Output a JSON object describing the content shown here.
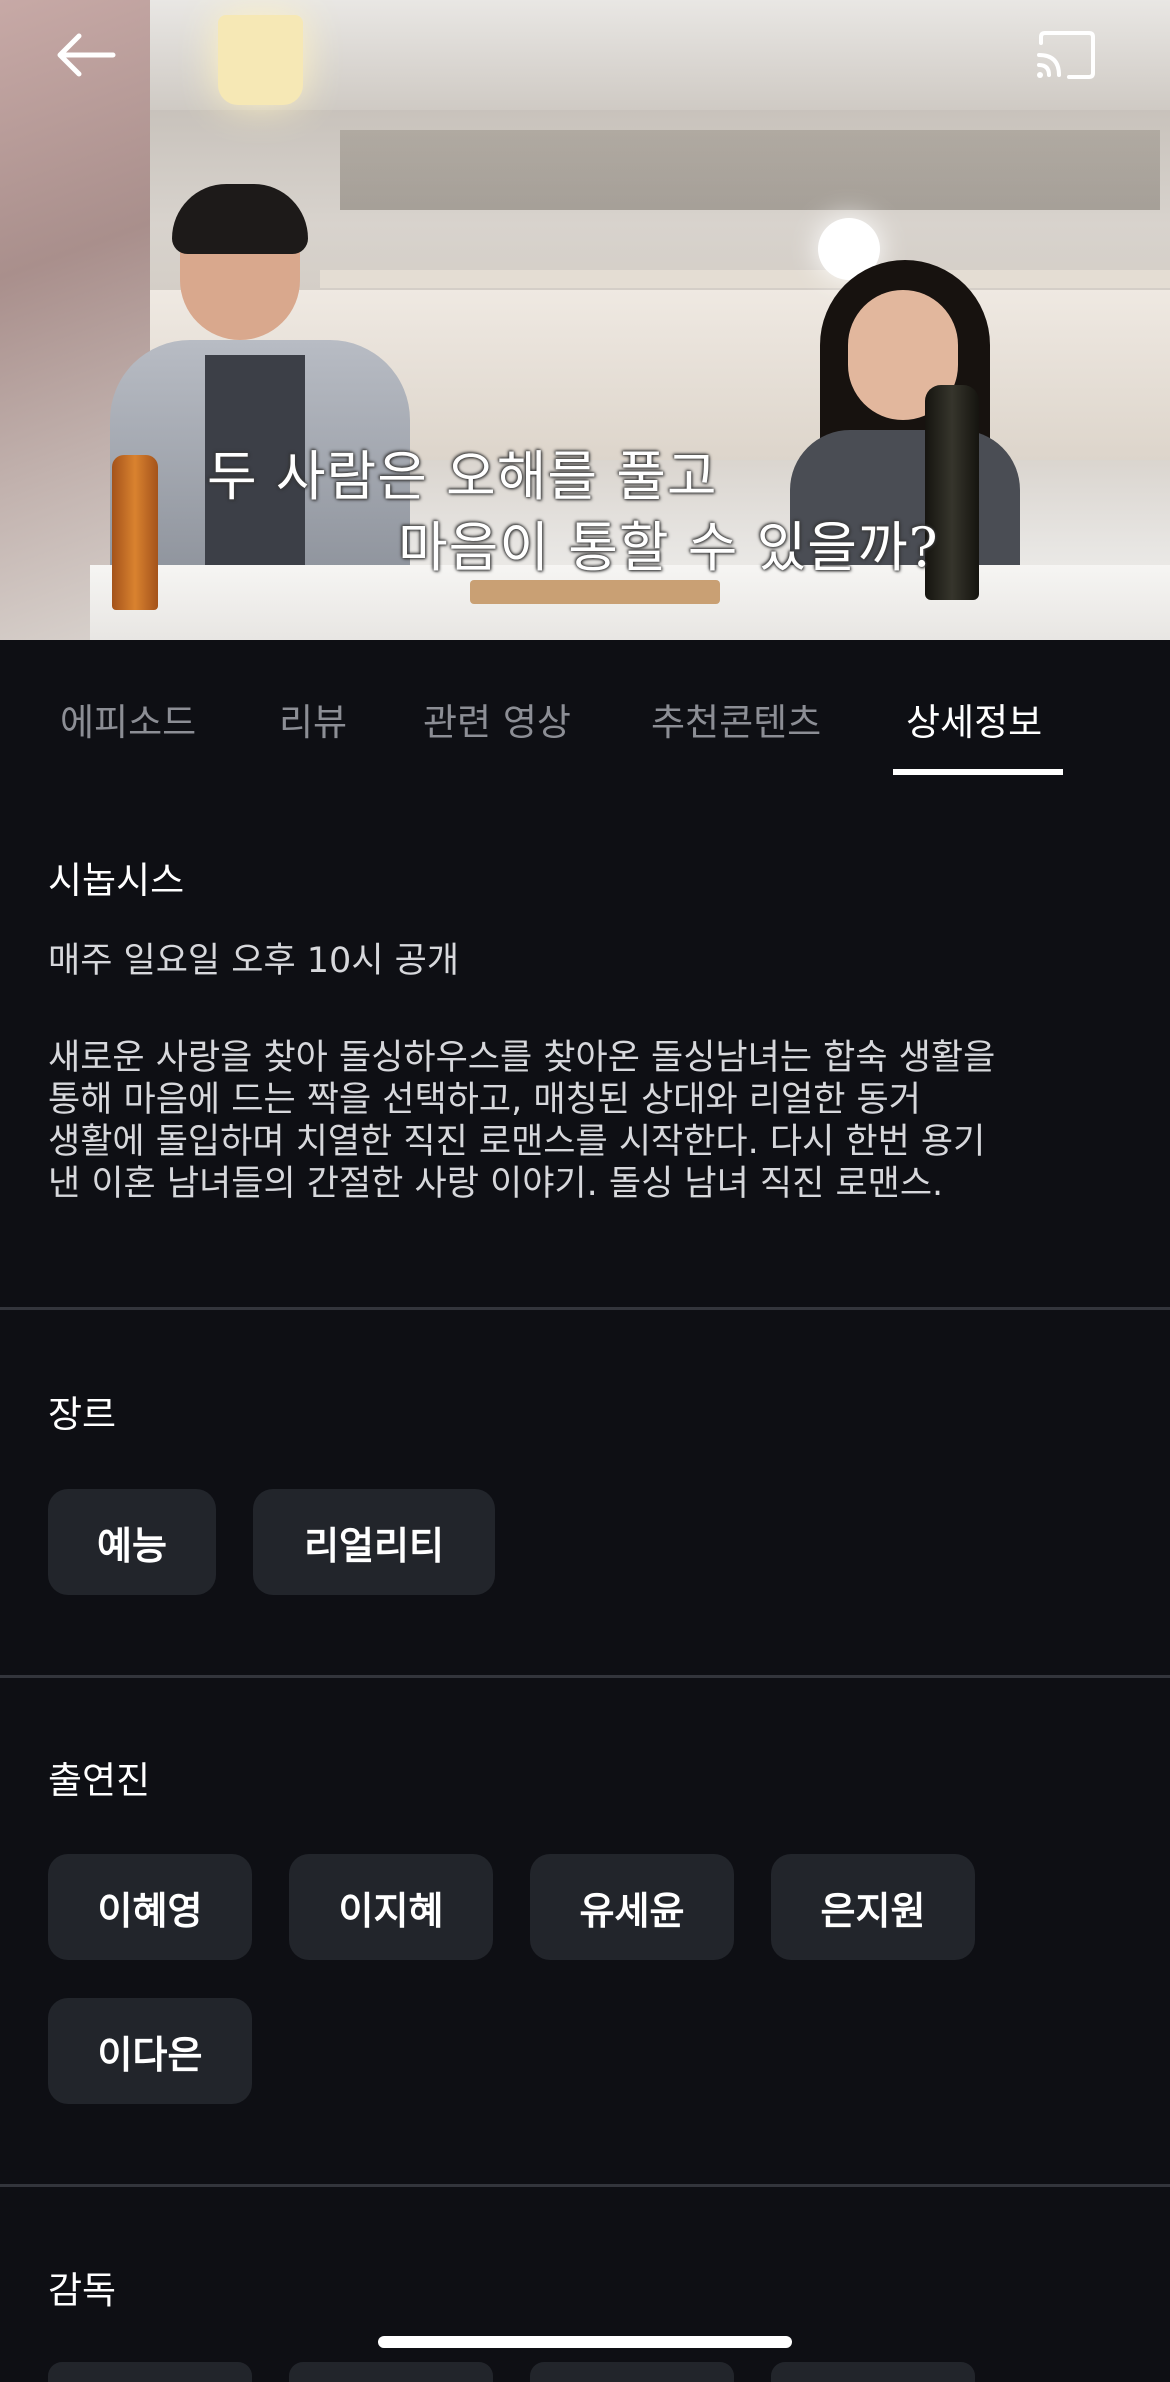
{
  "video": {
    "subtitle_line1": "두 사람은 오해를 풀고",
    "subtitle_line2": "마음이 통할 수 있을까?"
  },
  "header": {
    "back_icon": "back-arrow-icon",
    "cast_icon": "cast-icon"
  },
  "tabs": [
    {
      "label": "에피소드",
      "active": false
    },
    {
      "label": "리뷰",
      "active": false
    },
    {
      "label": "관련 영상",
      "active": false
    },
    {
      "label": "추천콘텐츠",
      "active": false
    },
    {
      "label": "상세정보",
      "active": true
    }
  ],
  "synopsis": {
    "title": "시놉시스",
    "schedule": "매주 일요일 오후 10시 공개",
    "description_lines": [
      "새로운 사랑을 찾아 돌싱하우스를 찾아온 돌싱남녀는 합숙 생활을",
      "통해 마음에 드는 짝을 선택하고, 매칭된 상대와 리얼한 동거",
      "생활에 돌입하며 치열한 직진 로맨스를 시작한다. 다시 한번 용기",
      "낸 이혼 남녀들의 간절한 사랑 이야기. 돌싱 남녀 직진 로맨스."
    ]
  },
  "genre": {
    "title": "장르",
    "items": [
      "예능",
      "리얼리티"
    ]
  },
  "cast": {
    "title": "출연진",
    "items": [
      "이혜영",
      "이지혜",
      "유세윤",
      "은지원",
      "이다은"
    ]
  },
  "director": {
    "title": "감독"
  },
  "colors": {
    "background": "#0e0f14",
    "chip": "#22252b",
    "divider": "#33353c",
    "tab_inactive": "#8c8e95",
    "text": "#ffffff"
  }
}
